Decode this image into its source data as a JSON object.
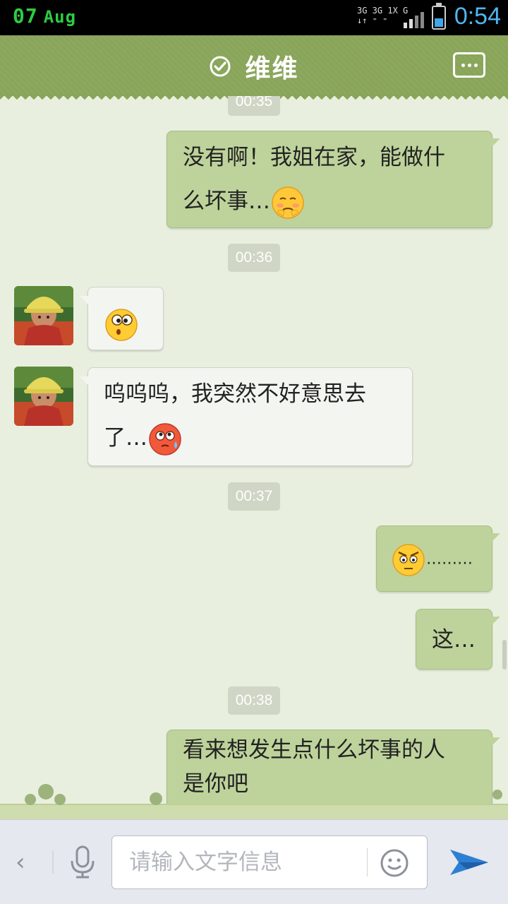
{
  "status_bar": {
    "day": "07",
    "month": "Aug",
    "network": "3G 3G 1X  G",
    "time": "0:54"
  },
  "title_bar": {
    "title": "维维",
    "verified_icon": "check-circle-icon",
    "more_icon": "more-dots-icon"
  },
  "messages": [
    {
      "type": "time",
      "text": "00:35"
    },
    {
      "type": "message",
      "from": "me",
      "text": "没有啊！我姐在家，能做什",
      "text2": "么坏事…",
      "emoji": "shy-emoji"
    },
    {
      "type": "time",
      "text": "00:36"
    },
    {
      "type": "message",
      "from": "them",
      "emoji": "surprised-emoji"
    },
    {
      "type": "message",
      "from": "them",
      "text": "呜呜呜，我突然不好意思去",
      "text2": "了…",
      "emoji": "sweat-emoji"
    },
    {
      "type": "time",
      "text": "00:37"
    },
    {
      "type": "message",
      "from": "me",
      "emoji": "glare-emoji",
      "text": "………"
    },
    {
      "type": "message",
      "from": "me",
      "text": "这…"
    },
    {
      "type": "time",
      "text": "00:38"
    },
    {
      "type": "message",
      "from": "me",
      "text": "看来想发生点什么坏事的人",
      "text2": "是你吧"
    }
  ],
  "input_bar": {
    "back_icon": "chevron-left-icon",
    "voice_icon": "microphone-icon",
    "placeholder": "请输入文字信息",
    "emoji_icon": "smiley-icon",
    "send_icon": "send-plane-icon"
  },
  "colors": {
    "title_bar": "#89a55a",
    "my_bubble": "#bed39b",
    "their_bubble": "#f3f5f1",
    "background": "#e9efdf",
    "status_time": "#4fb6f0",
    "status_date": "#2ecc40"
  }
}
